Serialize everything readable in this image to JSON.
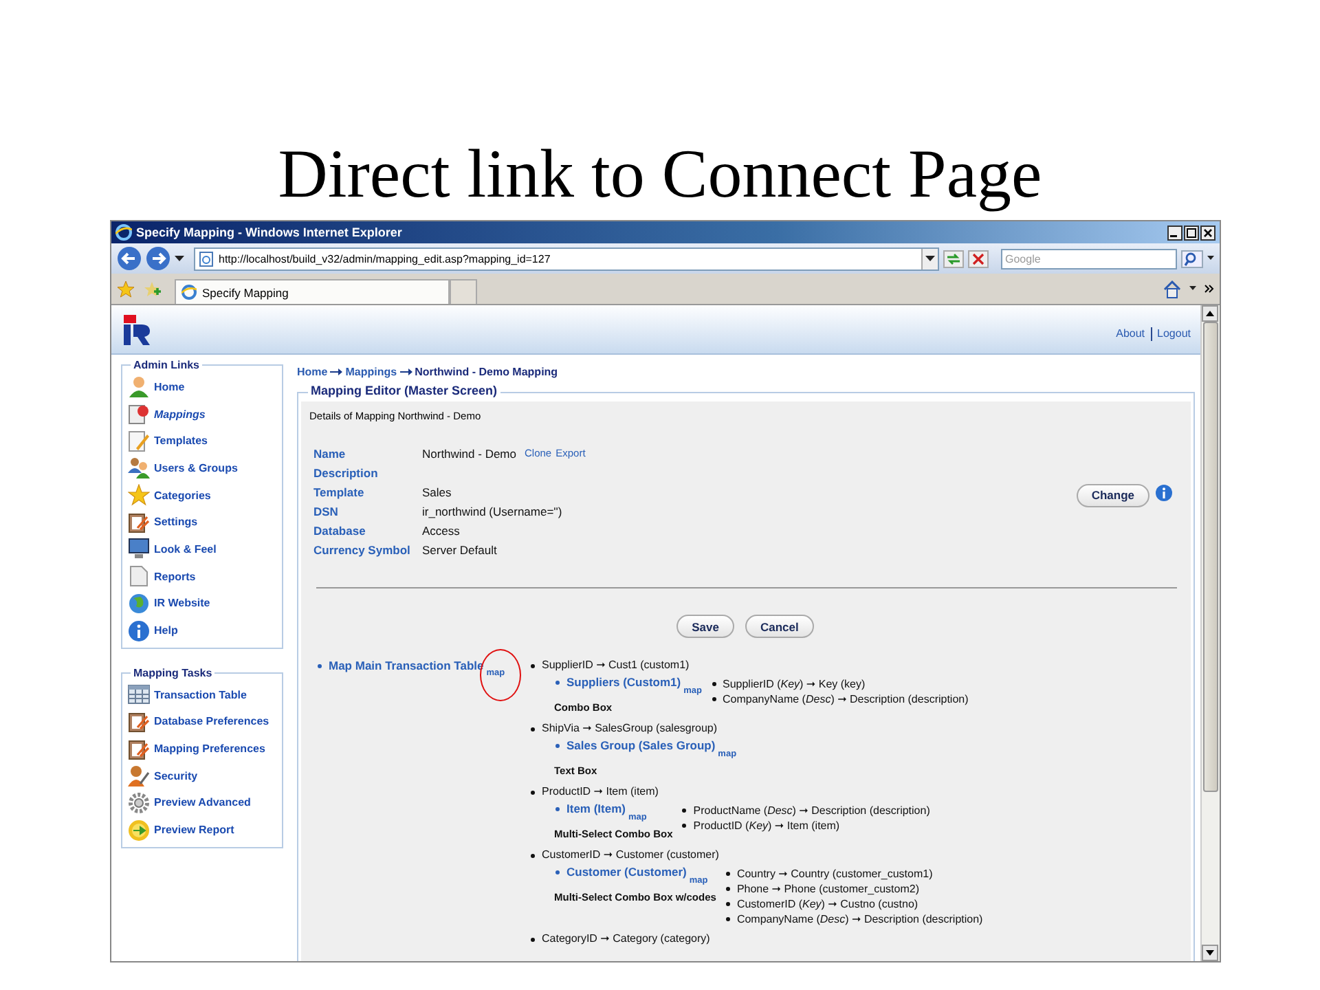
{
  "slide_title": "Direct link to Connect Page",
  "window": {
    "title": "Specify Mapping - Windows Internet Explorer"
  },
  "address_bar": {
    "url": "http://localhost/build_v32/admin/mapping_edit.asp?mapping_id=127"
  },
  "search": {
    "placeholder": "Google"
  },
  "tabs": [
    {
      "label": "Specify Mapping",
      "selected": true
    }
  ],
  "header": {
    "links": [
      "About",
      "Logout"
    ]
  },
  "sidebar": [
    {
      "title": "Admin Links",
      "items": [
        {
          "label": "Home",
          "selected": false
        },
        {
          "label": "Mappings",
          "selected": true
        },
        {
          "label": "Templates",
          "selected": false
        },
        {
          "label": "Users & Groups",
          "selected": false
        },
        {
          "label": "Categories",
          "selected": false
        },
        {
          "label": "Settings",
          "selected": false
        },
        {
          "label": "Look & Feel",
          "selected": false
        },
        {
          "label": "Reports",
          "selected": false
        },
        {
          "label": "IR Website",
          "selected": false
        },
        {
          "label": "Help",
          "selected": false
        }
      ]
    },
    {
      "title": "Mapping Tasks",
      "items": [
        {
          "label": "Transaction Table",
          "selected": false
        },
        {
          "label": "Database Preferences",
          "selected": false
        },
        {
          "label": "Mapping Preferences",
          "selected": false
        },
        {
          "label": "Security",
          "selected": false
        },
        {
          "label": "Preview Advanced",
          "selected": false
        },
        {
          "label": "Preview Report",
          "selected": false
        }
      ]
    }
  ],
  "breadcrumb": [
    {
      "label": "Home",
      "current": false
    },
    {
      "label": "Mappings",
      "current": false
    },
    {
      "label": "Northwind - Demo Mapping",
      "current": true
    }
  ],
  "editor": {
    "legend": "Mapping Editor (Master Screen)",
    "caption": "Details of Mapping Northwind - Demo",
    "fields": [
      {
        "label": "Name",
        "value": "Northwind - Demo",
        "links": [
          "Clone",
          "Export"
        ]
      },
      {
        "label": "Description"
      },
      {
        "label": "Template",
        "value": "Sales"
      },
      {
        "label": "DSN",
        "value": "ir_northwind (Username='')"
      },
      {
        "label": "Database",
        "value": "Access"
      },
      {
        "label": "Currency Symbol",
        "value": "Server Default"
      }
    ],
    "change_button": "Change",
    "buttons": [
      "Save",
      "Cancel"
    ]
  },
  "mapping": {
    "table": "Map Main Transaction Table",
    "map_link": "map",
    "circled": true,
    "columns": [
      {
        "source": "SupplierID ➞ Cust1 (custom1)",
        "table": "Suppliers (Custom1)",
        "map": "map",
        "control": "Combo Box",
        "fields": [
          "SupplierID (*Key*) ➞ Key (key)",
          "CompanyName (*Desc*) ➞ Description (description)"
        ]
      },
      {
        "source": "ShipVia ➞ SalesGroup (salesgroup)",
        "table": "Sales Group (Sales Group)",
        "map": "map",
        "control": "Text Box"
      },
      {
        "source": "ProductID ➞ Item (item)",
        "table": "Item (Item)",
        "map": "map",
        "control": "Multi-Select Combo Box",
        "fields": [
          "ProductName (*Desc*) ➞ Description (description)",
          "ProductID (*Key*) ➞ Item (item)"
        ]
      },
      {
        "source": "CustomerID ➞ Customer (customer)",
        "table": "Customer (Customer)",
        "map": "map",
        "control": "Multi-Select Combo Box w/codes",
        "fields": [
          "Country ➞ Country (customer_custom1)",
          "Phone ➞ Phone (customer_custom2)",
          "CustomerID (*Key*) ➞ Custno (custno)",
          "CompanyName (*Desc*) ➞ Description (description)"
        ]
      },
      {
        "source": "CategoryID ➞ Category (category)"
      }
    ]
  }
}
